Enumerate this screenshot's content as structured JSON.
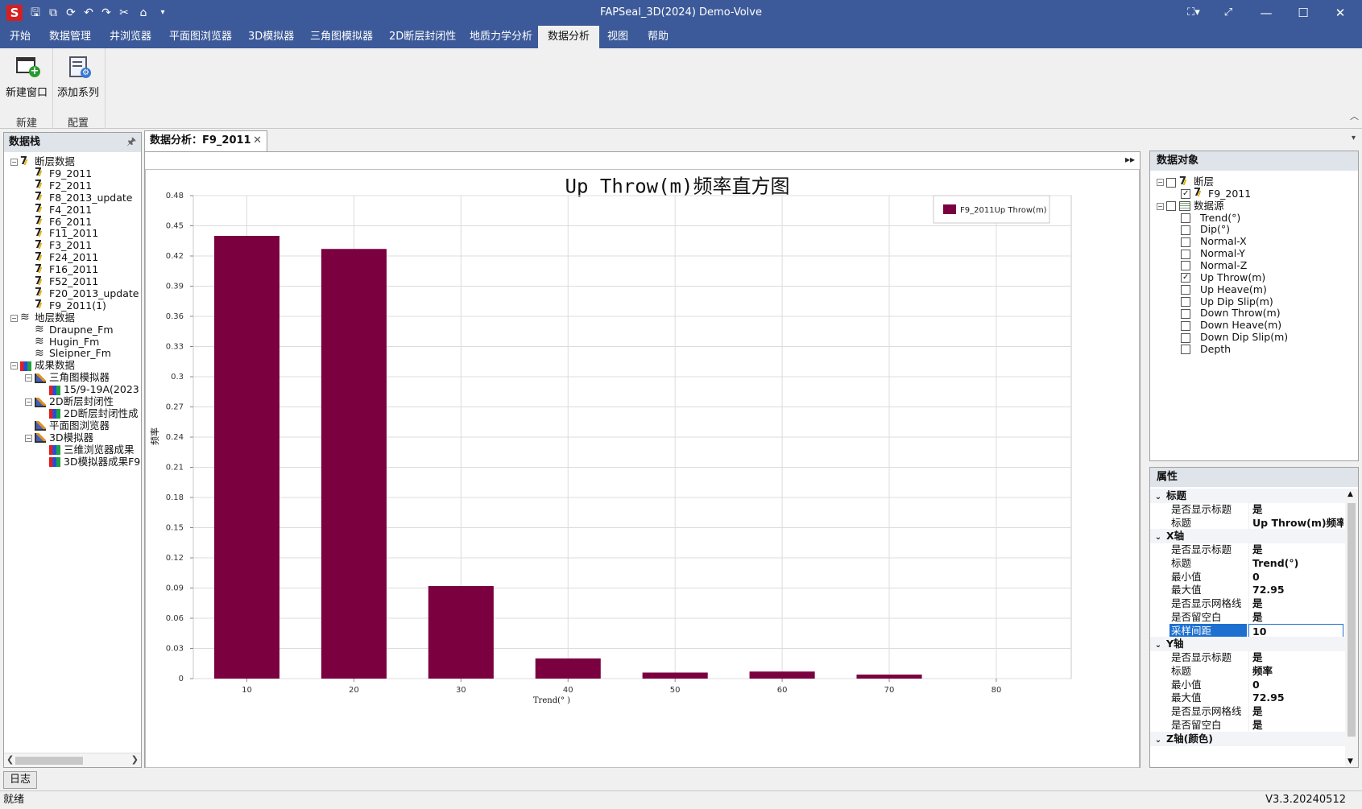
{
  "window": {
    "title": "FAPSeal_3D(2024) Demo-Volve",
    "logo_text": "S"
  },
  "quick_access": [
    "save-icon",
    "save-all-icon",
    "refresh-icon",
    "undo-icon",
    "redo-icon",
    "cut-icon",
    "home-icon",
    "dropdown-icon"
  ],
  "menu": [
    "开始",
    "数据管理",
    "井浏览器",
    "平面图浏览器",
    "3D模拟器",
    "三角图模拟器",
    "2D断层封闭性",
    "地质力学分析",
    "数据分析",
    "视图",
    "帮助"
  ],
  "menu_active_index": 8,
  "ribbon": {
    "buttons": [
      {
        "label": "新建窗口",
        "icon": "new-window-icon"
      },
      {
        "label": "添加系列",
        "icon": "add-series-icon"
      }
    ],
    "groups": [
      "新建",
      "配置"
    ]
  },
  "left_panel": {
    "title": "数据栈",
    "tree": [
      {
        "label": "断层数据",
        "level": 0,
        "icon": "fault",
        "exp": "⊟"
      },
      {
        "label": "F9_2011",
        "level": 1,
        "icon": "fault"
      },
      {
        "label": "F2_2011",
        "level": 1,
        "icon": "fault"
      },
      {
        "label": "F8_2013_update",
        "level": 1,
        "icon": "fault"
      },
      {
        "label": "F4_2011",
        "level": 1,
        "icon": "fault"
      },
      {
        "label": "F6_2011",
        "level": 1,
        "icon": "fault"
      },
      {
        "label": "F11_2011",
        "level": 1,
        "icon": "fault"
      },
      {
        "label": "F3_2011",
        "level": 1,
        "icon": "fault"
      },
      {
        "label": "F24_2011",
        "level": 1,
        "icon": "fault"
      },
      {
        "label": "F16_2011",
        "level": 1,
        "icon": "fault"
      },
      {
        "label": "F52_2011",
        "level": 1,
        "icon": "fault"
      },
      {
        "label": "F20_2013_update",
        "level": 1,
        "icon": "fault"
      },
      {
        "label": "F9_2011(1)",
        "level": 1,
        "icon": "fault"
      },
      {
        "label": "地层数据",
        "level": 0,
        "icon": "layer",
        "exp": "⊟"
      },
      {
        "label": "Draupne_Fm",
        "level": 1,
        "icon": "layer"
      },
      {
        "label": "Hugin_Fm",
        "level": 1,
        "icon": "layer"
      },
      {
        "label": "Sleipner_Fm",
        "level": 1,
        "icon": "layer"
      },
      {
        "label": "成果数据",
        "level": 0,
        "icon": "result",
        "exp": "⊟"
      },
      {
        "label": "三角图模拟器",
        "level": 1,
        "icon": "sim",
        "exp": "⊟"
      },
      {
        "label": "15/9-19A(2023",
        "level": 2,
        "icon": "result"
      },
      {
        "label": "2D断层封闭性",
        "level": 1,
        "icon": "sim",
        "exp": "⊟"
      },
      {
        "label": "2D断层封闭性成",
        "level": 2,
        "icon": "result"
      },
      {
        "label": "平面图浏览器",
        "level": 1,
        "icon": "sim"
      },
      {
        "label": "3D模拟器",
        "level": 1,
        "icon": "sim",
        "exp": "⊟"
      },
      {
        "label": "三维浏览器成果",
        "level": 2,
        "icon": "result"
      },
      {
        "label": "3D模拟器成果F9",
        "level": 2,
        "icon": "result"
      }
    ]
  },
  "document_tab": {
    "label": "数据分析：F9_2011"
  },
  "chart_data": {
    "type": "bar",
    "title": "Up Throw(m)频率直方图",
    "xlabel": "Trend(° )",
    "ylabel": "频率",
    "categories": [
      "10",
      "20",
      "30",
      "40",
      "50",
      "60",
      "70",
      "80"
    ],
    "series": [
      {
        "name": "F9_2011Up Throw(m)",
        "color": "#7b0040",
        "values": [
          0.44,
          0.427,
          0.092,
          0.02,
          0.006,
          0.007,
          0.004,
          0
        ]
      }
    ],
    "ylim": [
      0,
      0.48
    ],
    "yticks": [
      "0",
      "0.03",
      "0.06",
      "0.09",
      "0.12",
      "0.15",
      "0.18",
      "0.21",
      "0.24",
      "0.27",
      "0.3",
      "0.33",
      "0.36",
      "0.39",
      "0.42",
      "0.45",
      "0.48"
    ],
    "grid": true,
    "legend": "top-right"
  },
  "objects_panel": {
    "title": "数据对象",
    "items": [
      {
        "label": "断层",
        "level": 0,
        "checked": false,
        "exp": "⊟",
        "icon": "fault"
      },
      {
        "label": "F9_2011",
        "level": 1,
        "checked": true,
        "icon": "fault"
      },
      {
        "label": "数据源",
        "level": 0,
        "checked": false,
        "exp": "⊟",
        "icon": "table"
      },
      {
        "label": "Trend(°)",
        "level": 1,
        "checked": false
      },
      {
        "label": "Dip(°)",
        "level": 1,
        "checked": false
      },
      {
        "label": "Normal-X",
        "level": 1,
        "checked": false
      },
      {
        "label": "Normal-Y",
        "level": 1,
        "checked": false
      },
      {
        "label": "Normal-Z",
        "level": 1,
        "checked": false
      },
      {
        "label": "Up Throw(m)",
        "level": 1,
        "checked": true
      },
      {
        "label": "Up Heave(m)",
        "level": 1,
        "checked": false
      },
      {
        "label": "Up Dip Slip(m)",
        "level": 1,
        "checked": false
      },
      {
        "label": "Down Throw(m)",
        "level": 1,
        "checked": false
      },
      {
        "label": "Down Heave(m)",
        "level": 1,
        "checked": false
      },
      {
        "label": "Down Dip Slip(m)",
        "level": 1,
        "checked": false
      },
      {
        "label": "Depth",
        "level": 1,
        "checked": false
      }
    ]
  },
  "properties_panel": {
    "title": "属性",
    "rows": [
      {
        "group": "标题"
      },
      {
        "key": "是否显示标题",
        "value": "是"
      },
      {
        "key": "标题",
        "value": "Up Throw(m)频率直"
      },
      {
        "group": "X轴"
      },
      {
        "key": "是否显示标题",
        "value": "是"
      },
      {
        "key": "标题",
        "value": "Trend(°)"
      },
      {
        "key": "最小值",
        "value": "0"
      },
      {
        "key": "最大值",
        "value": "72.95"
      },
      {
        "key": "是否显示网格线",
        "value": "是"
      },
      {
        "key": "是否留空白",
        "value": "是"
      },
      {
        "key": "采样间距",
        "value": "10",
        "selected": true
      },
      {
        "group": "Y轴"
      },
      {
        "key": "是否显示标题",
        "value": "是"
      },
      {
        "key": "标题",
        "value": "频率"
      },
      {
        "key": "最小值",
        "value": "0"
      },
      {
        "key": "最大值",
        "value": "72.95"
      },
      {
        "key": "是否显示网格线",
        "value": "是"
      },
      {
        "key": "是否留空白",
        "value": "是"
      },
      {
        "group": "Z轴(颜色)"
      }
    ]
  },
  "bottom_tab": {
    "label": "日志"
  },
  "status": {
    "left": "就绪",
    "right": "V3.3.20240512"
  }
}
